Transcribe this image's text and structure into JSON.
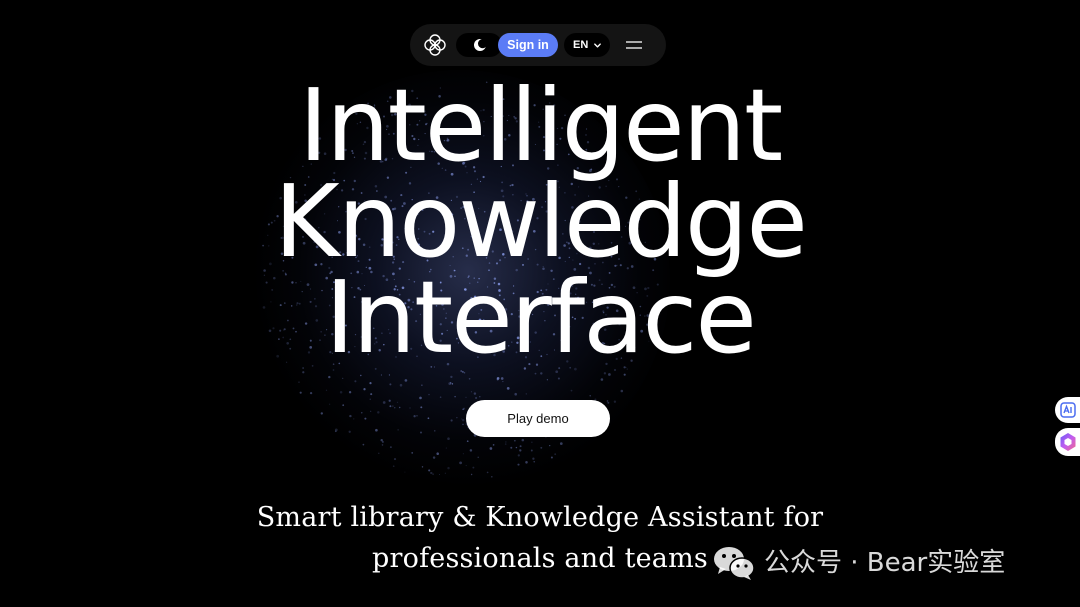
{
  "nav": {
    "signin_label": "Sign in",
    "language": "EN"
  },
  "hero": {
    "headline_lines": [
      "Intelligent",
      "Knowledge",
      "Interface"
    ],
    "cta_label": "Play demo",
    "subtitle_lines": [
      "Smart library & Knowledge Assistant for",
      "professionals and teams"
    ]
  },
  "watermark": {
    "text": "公众号 · Bear实验室"
  },
  "icons": {
    "logo": "four-petal-logo-icon",
    "theme": "moon-icon",
    "language_dropdown": "chevron-down-icon",
    "menu": "hamburger-menu-icon",
    "watermark": "wechat-icon",
    "side_1": "translate-ai-icon",
    "side_2": "hexagon-app-icon"
  },
  "colors": {
    "background": "#000000",
    "nav_bg": "#141414",
    "accent": "#5b7cf6",
    "cta_bg": "#ffffff"
  }
}
